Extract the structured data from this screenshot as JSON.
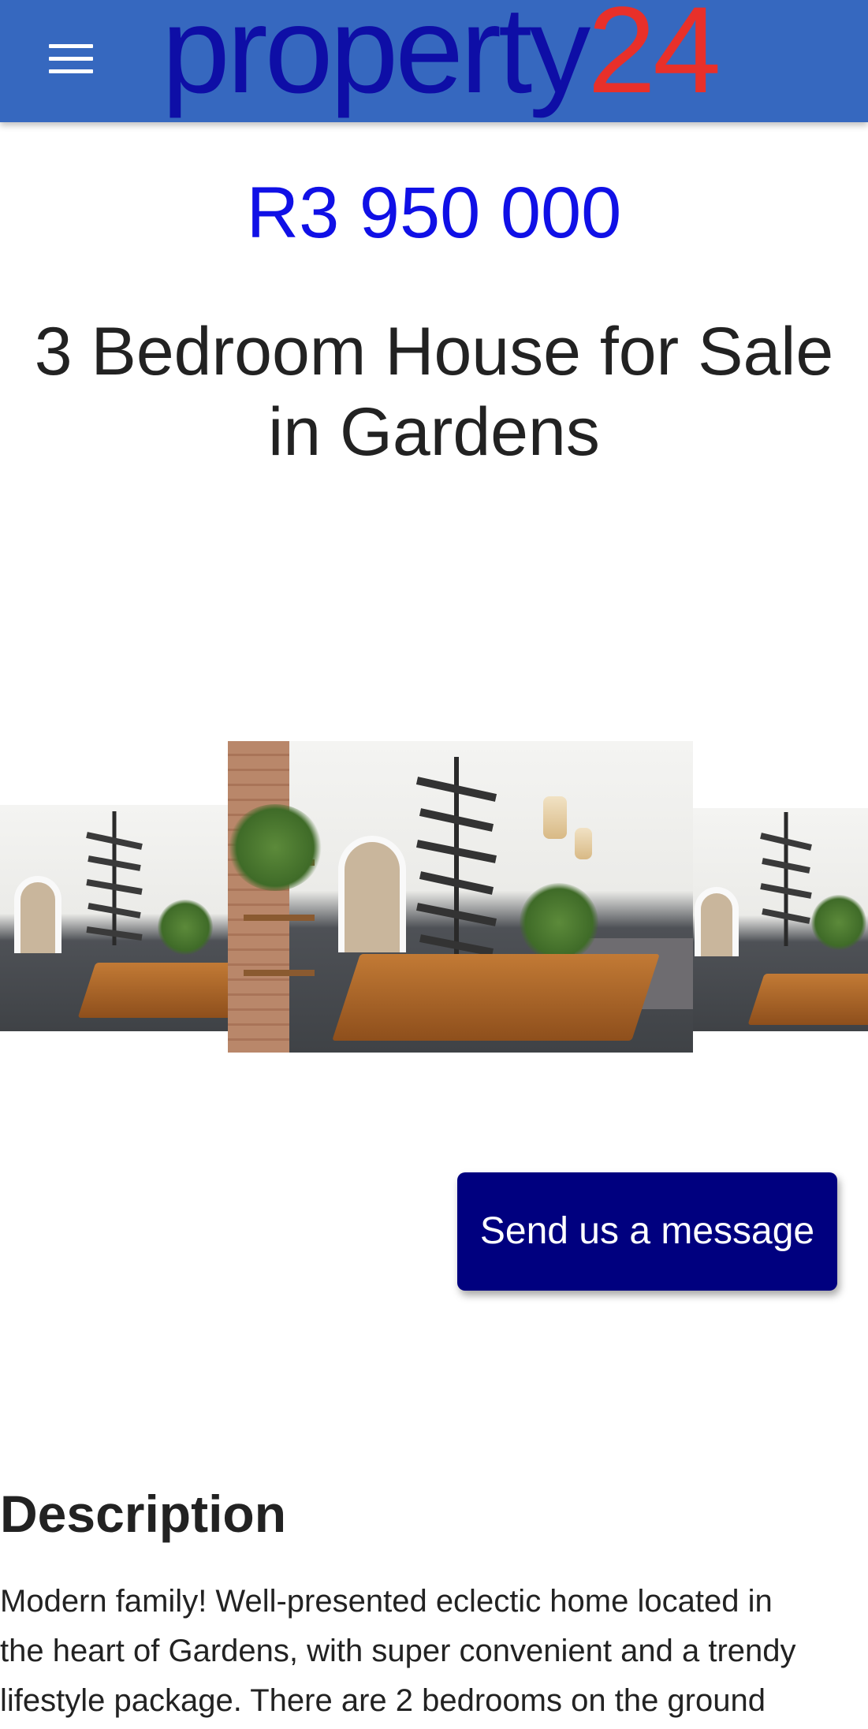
{
  "header": {
    "menu_icon": "hamburger-menu-icon",
    "logo_word": "property",
    "logo_number": "24",
    "colors": {
      "bar": "#3668bf",
      "logo_word": "#0e0ea6",
      "logo_number": "#e8302a"
    }
  },
  "listing": {
    "price": "R3 950 000",
    "title_line1": "3 Bedroom House for Sale",
    "title_line2": "in Gardens"
  },
  "actions": {
    "message_label": "Send us a message"
  },
  "description": {
    "heading": "Description",
    "lines": [
      "Modern family! Well-presented eclectic home located in",
      "the heart of Gardens, with super convenient and a trendy",
      "lifestyle package. There are 2 bedrooms on the ground"
    ]
  },
  "colors": {
    "price": "#1010e6",
    "button": "#00007f"
  }
}
